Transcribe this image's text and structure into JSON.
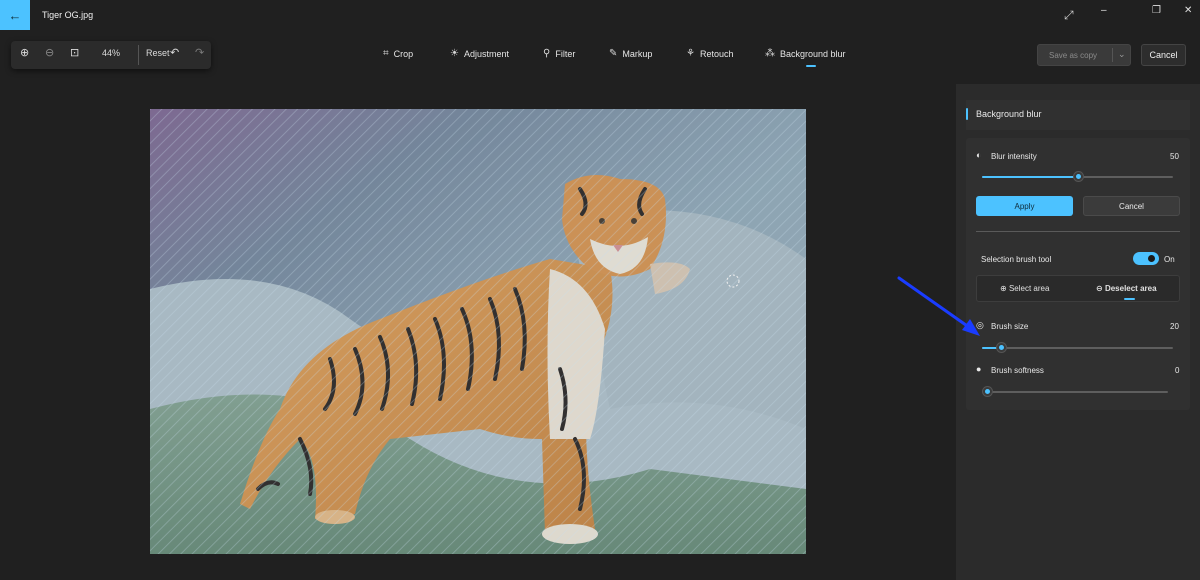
{
  "titlebar": {
    "title": "Tiger OG.jpg",
    "back_icon": "arrow-left-icon",
    "expand_icon": "expand-icon",
    "minimize": "–",
    "maximize": "❐",
    "close": "✕"
  },
  "zoom_group": {
    "zoom_in": "⊕",
    "zoom_out": "⊖",
    "fit": "⊡",
    "zoom_level": "44%",
    "reset": "Reset",
    "undo": "↶",
    "redo": "↷"
  },
  "tools": [
    {
      "label": "Crop",
      "icon": "⌗"
    },
    {
      "label": "Adjustment",
      "icon": "☀"
    },
    {
      "label": "Filter",
      "icon": "⚲"
    },
    {
      "label": "Markup",
      "icon": "✎"
    },
    {
      "label": "Retouch",
      "icon": "⚘"
    },
    {
      "label": "Background blur",
      "icon": "⁂"
    }
  ],
  "actions": {
    "save_as_copy": "Save as copy",
    "save_chevron": "⌄",
    "cancel": "Cancel"
  },
  "panel": {
    "title": "Background blur",
    "blur_intensity_label": "Blur intensity",
    "blur_intensity_value": "50",
    "blur_intensity_fraction": 0.5,
    "apply": "Apply",
    "cancel": "Cancel",
    "selection_brush_label": "Selection brush tool",
    "selection_brush_state": "On",
    "select_area": "Select area",
    "deselect_area": "Deselect area",
    "brush_size_label": "Brush size",
    "brush_size_value": "20",
    "brush_size_fraction": 0.1,
    "brush_softness_label": "Brush softness",
    "brush_softness_value": "0",
    "brush_softness_fraction": 0.0
  },
  "colors": {
    "accent": "#4cc2ff",
    "background": "#202020",
    "panel": "#2b2b2b",
    "annotation_arrow": "#1a3cff"
  }
}
